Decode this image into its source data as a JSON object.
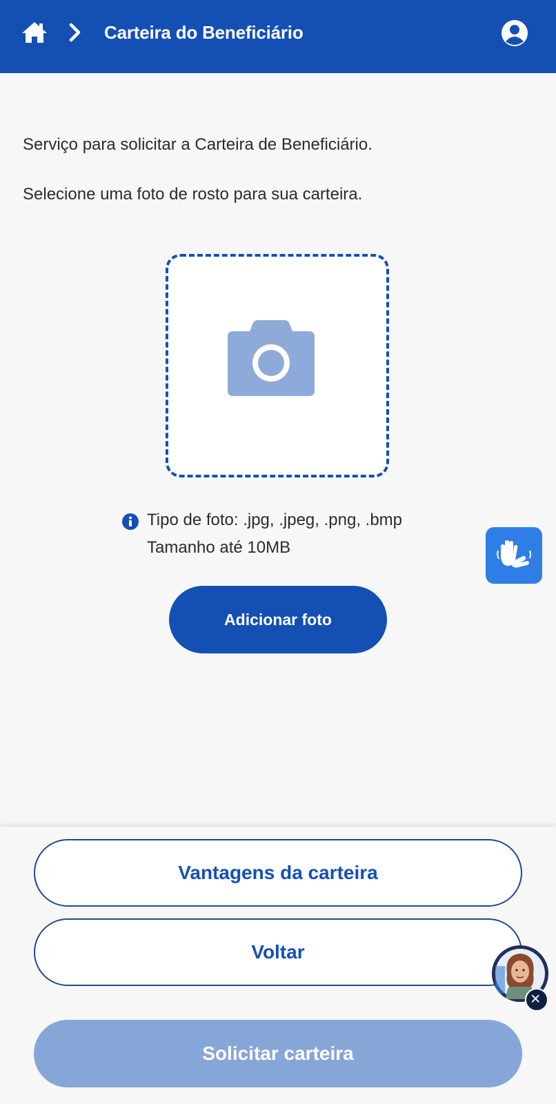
{
  "header": {
    "title": "Carteira do Beneficiário",
    "home_icon": "home-icon",
    "separator_icon": "chevron-right-icon",
    "user_icon": "user-circle-icon",
    "background": "#1450b4"
  },
  "main": {
    "intro_line1": "Serviço para solicitar a Carteira de Beneficiário.",
    "intro_line2": "Selecione uma foto de rosto para sua carteira.",
    "photo_placeholder_icon": "camera-icon",
    "info_icon": "info-icon",
    "info_line1": "Tipo de foto: .jpg, .jpeg, .png, .bmp",
    "info_line2": "Tamanho até 10MB",
    "add_photo_label": "Adicionar foto"
  },
  "floating": {
    "accessibility_icon": "sign-language-hands-icon",
    "assistant_avatar_icon": "assistant-avatar-icon",
    "assistant_close_icon": "close-icon"
  },
  "bottom": {
    "vantagens_label": "Vantagens da carteira",
    "voltar_label": "Voltar",
    "solicitar_label": "Solicitar carteira"
  },
  "colors": {
    "primary": "#1450b4",
    "disabled_button": "#87a6d8",
    "libras_button": "#2f7ee6",
    "camera_icon": "#8eaad9"
  }
}
